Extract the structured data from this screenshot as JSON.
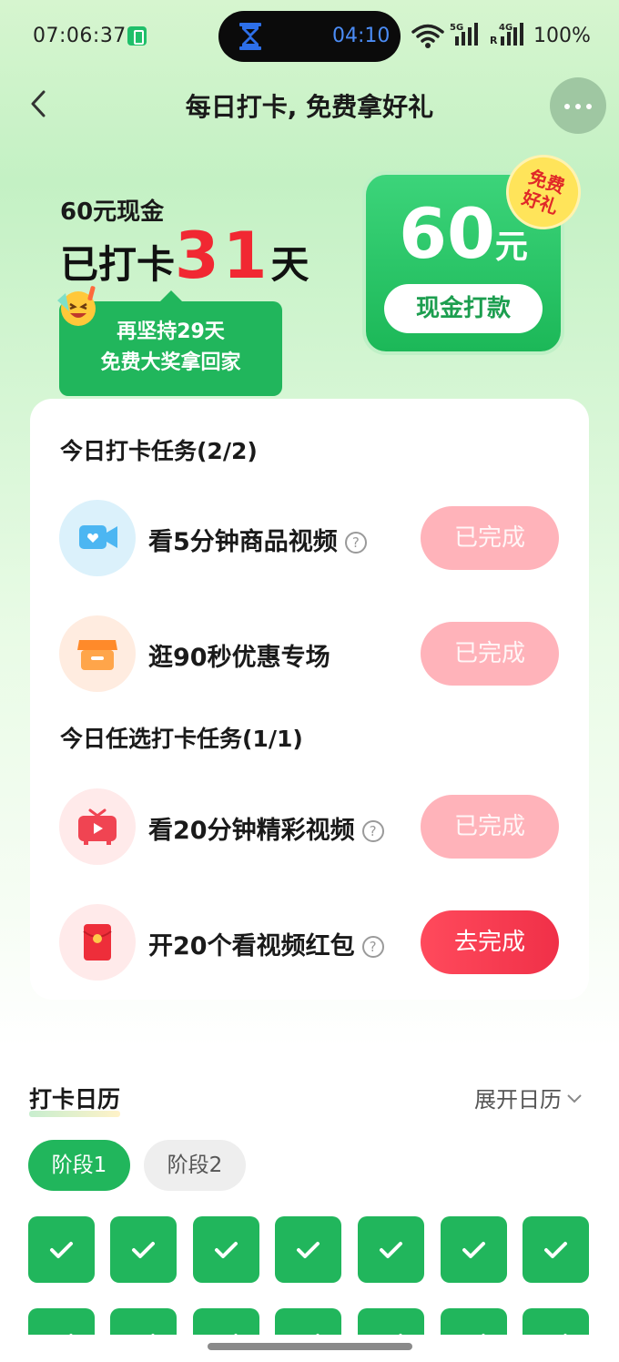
{
  "status_bar": {
    "time": "07:06:37",
    "island_time": "04:10",
    "signal_5g": "5G",
    "signal_4g": "4G",
    "roaming": "R",
    "battery": "100%"
  },
  "nav": {
    "title": "每日打卡, 免费拿好礼"
  },
  "header": {
    "reward_label": "60元现金",
    "checked_prefix": "已打卡",
    "checked_days": "31",
    "checked_suffix": "天",
    "tip_line1": "再坚持29天",
    "tip_line2": "免费大奖拿回家"
  },
  "cash_card": {
    "amount": "60",
    "unit": "元",
    "button": "现金打款",
    "badge_line1": "免费",
    "badge_line2": "好礼"
  },
  "tasks": {
    "daily_title": "今日打卡任务(2/2)",
    "optional_title": "今日任选打卡任务(1/1)",
    "help_symbol": "?",
    "items": [
      {
        "label": "看5分钟商品视频",
        "button": "已完成",
        "has_help": true
      },
      {
        "label": "逛90秒优惠专场",
        "button": "已完成",
        "has_help": false
      },
      {
        "label": "看20分钟精彩视频",
        "button": "已完成",
        "has_help": true
      },
      {
        "label": "开20个看视频红包",
        "button": "去完成",
        "has_help": true
      }
    ]
  },
  "calendar": {
    "title": "打卡日历",
    "expand": "展开日历",
    "stages": [
      "阶段1",
      "阶段2"
    ],
    "checked_days_visible": 14
  },
  "colors": {
    "brand_green": "#21b65c",
    "accent_red": "#f12832",
    "done_pink": "#ffb3ba",
    "go_red": "#f03048"
  }
}
